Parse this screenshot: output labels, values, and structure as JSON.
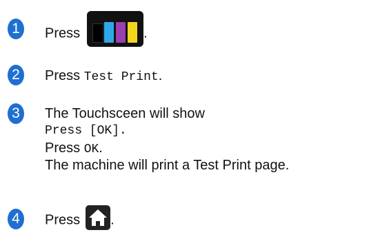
{
  "steps": [
    {
      "number": "1",
      "text": "Press",
      "suffix": "."
    },
    {
      "number": "2",
      "text": "Press ",
      "code": "Test Print",
      "suffix": "."
    },
    {
      "number": "3",
      "line1": "The Touchsceen will show",
      "line2_code": "Press [OK].",
      "line3_text": "Press ",
      "line3_code": "OK",
      "line3_suffix": ".",
      "line4": "The machine will print a Test Print page."
    },
    {
      "number": "4",
      "text": "Press",
      "suffix": "."
    }
  ],
  "icons": {
    "ink": "ink-cartridge-icon",
    "home": "home-icon"
  },
  "colors": {
    "badge": "#1f6fd1",
    "ink_black": "#000000",
    "ink_cyan": "#2fa8e8",
    "ink_magenta": "#9b3fb0",
    "ink_yellow": "#f2d51e"
  }
}
